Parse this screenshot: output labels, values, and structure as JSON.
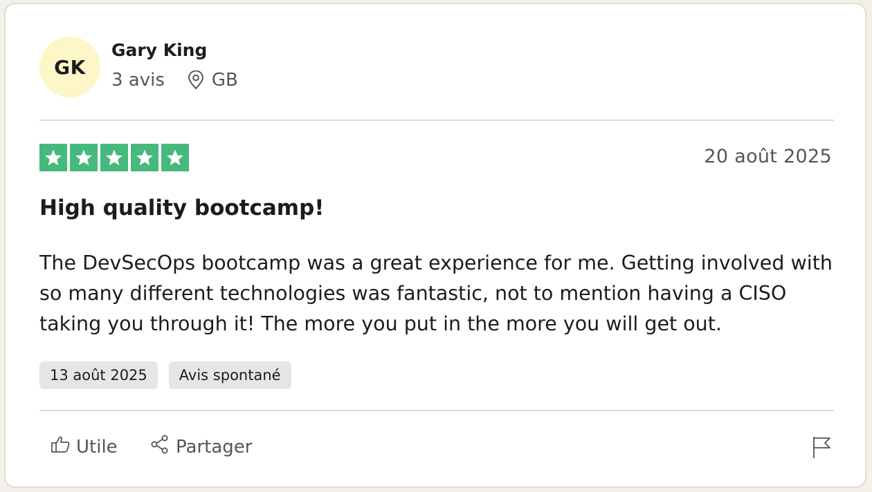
{
  "reviewer": {
    "initials": "GK",
    "name": "Gary King",
    "review_count": "3 avis",
    "country": "GB",
    "avatar_color": "#fcf6c8",
    "location_icon": "location-pin-icon"
  },
  "review": {
    "rating": 5,
    "max_rating": 5,
    "star_color": "#46b97d",
    "date": "20 août 2025",
    "title": "High quality bootcamp!",
    "body": "The DevSecOps bootcamp was a great experience for me. Getting involved with so many different technologies was fantastic, not to mention having a CISO taking you through it! The more you put in the more you will get out.",
    "tags": {
      "experience_date": "13 août 2025",
      "type": "Avis spontané"
    }
  },
  "actions": {
    "useful_label": "Utile",
    "useful_icon": "thumbs-up-icon",
    "share_label": "Partager",
    "share_icon": "share-icon",
    "report_icon": "flag-icon"
  }
}
